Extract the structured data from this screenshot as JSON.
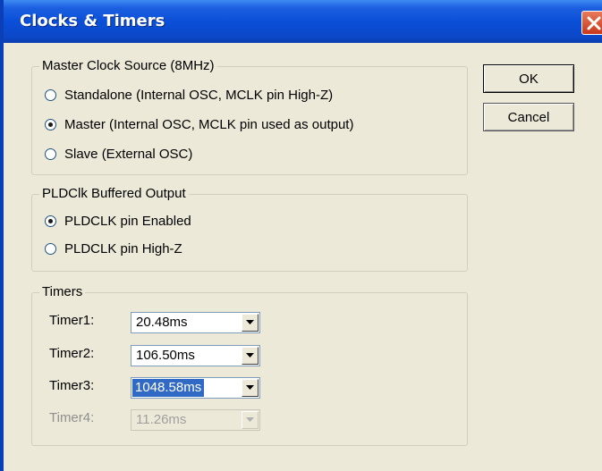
{
  "window": {
    "title": "Clocks & Timers"
  },
  "master_clock": {
    "label": "Master Clock Source (8MHz)",
    "options": [
      {
        "label": "Standalone (Internal OSC, MCLK pin High-Z)",
        "checked": false
      },
      {
        "label": "Master (Internal OSC, MCLK pin used as output)",
        "checked": true
      },
      {
        "label": "Slave (External OSC)",
        "checked": false
      }
    ]
  },
  "pldclk": {
    "label": "PLDClk Buffered Output",
    "options": [
      {
        "label": "PLDCLK pin Enabled",
        "checked": true
      },
      {
        "label": "PLDCLK pin High-Z",
        "checked": false
      }
    ]
  },
  "timers": {
    "label": "Timers",
    "items": [
      {
        "label": "Timer1:",
        "value": "20.48ms",
        "enabled": true,
        "selected": false
      },
      {
        "label": "Timer2:",
        "value": "106.50ms",
        "enabled": true,
        "selected": false
      },
      {
        "label": "Timer3:",
        "value": "1048.58ms",
        "enabled": true,
        "selected": true
      },
      {
        "label": "Timer4:",
        "value": "11.26ms",
        "enabled": false,
        "selected": false
      }
    ]
  },
  "buttons": {
    "ok": "OK",
    "cancel": "Cancel"
  },
  "colors": {
    "titlebar": "#0a4fd8",
    "selection": "#316ac5",
    "dialog_bg": "#ece9d8",
    "close": "#c9381a"
  },
  "icons": {
    "close": "close-icon",
    "dropdown": "chevron-down-icon"
  }
}
